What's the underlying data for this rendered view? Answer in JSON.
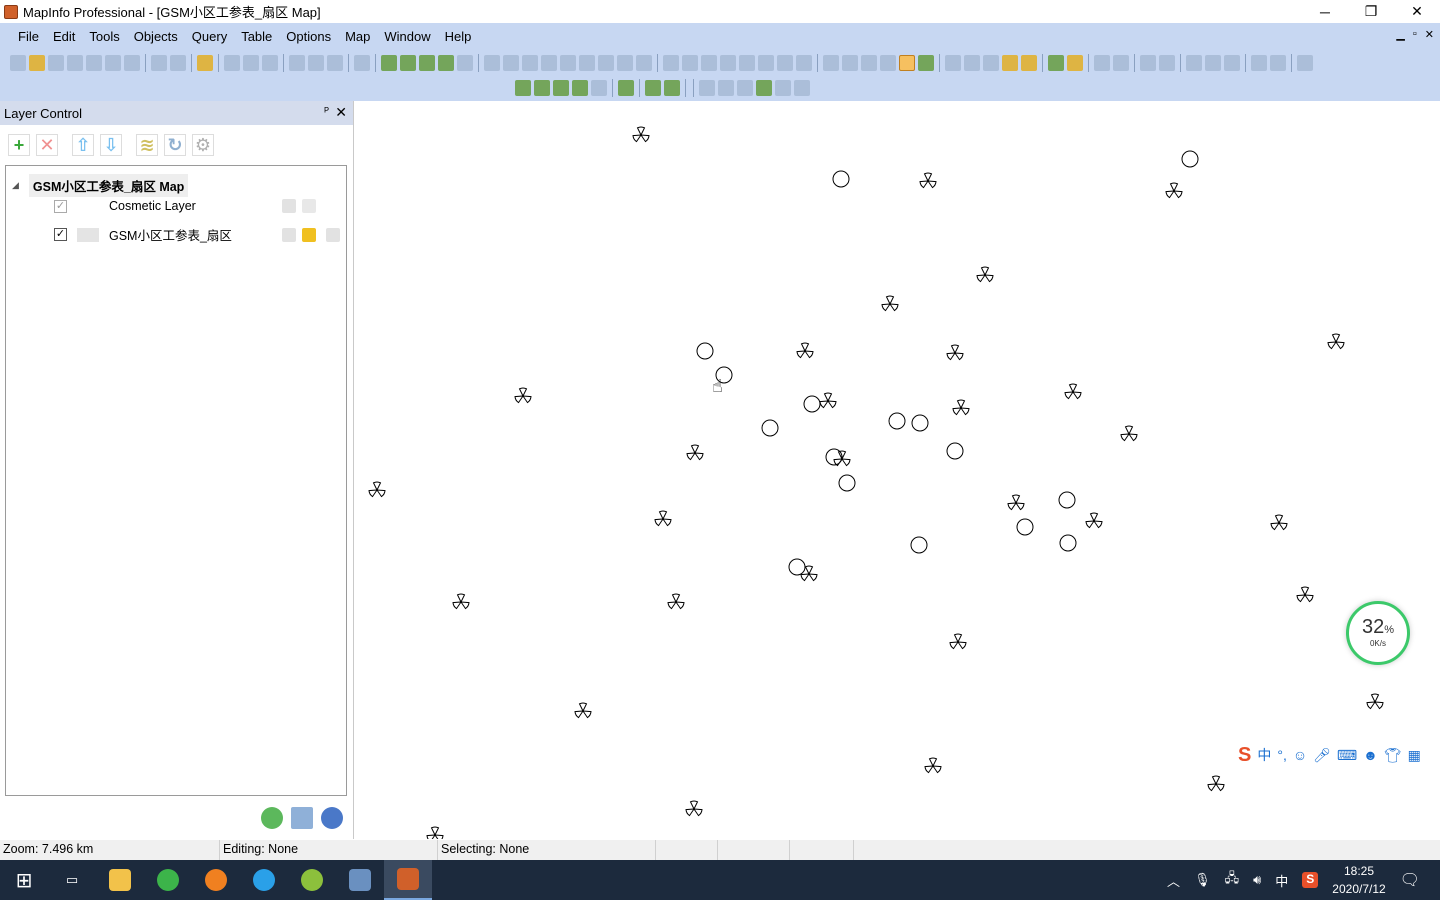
{
  "window": {
    "title": "MapInfo Professional - [GSM小区工参表_扇区 Map]",
    "minimize": "─",
    "restore": "❐",
    "close": "✕"
  },
  "menu": [
    "File",
    "Edit",
    "Tools",
    "Objects",
    "Query",
    "Table",
    "Options",
    "Map",
    "Window",
    "Help"
  ],
  "mdi_controls": [
    "▁",
    "▫",
    "✕"
  ],
  "layer_control": {
    "title": "Layer Control",
    "pin": "ᴾ",
    "close": "✕",
    "map_name": "GSM小区工参表_扇区 Map",
    "layers": [
      {
        "name": "Cosmetic Layer",
        "visible": true,
        "enabled": false
      },
      {
        "name": "GSM小区工参表_扇区",
        "visible": true,
        "enabled": true
      }
    ]
  },
  "status": {
    "zoom": "Zoom: 7.496 km",
    "editing": "Editing: None",
    "selecting": "Selecting: None"
  },
  "speed_widget": {
    "percent": "32",
    "unit": "%",
    "rate": "0K/s"
  },
  "ime_bar": {
    "label": "中"
  },
  "tray": {
    "lang": "中",
    "time": "18:25",
    "date": "2020/7/12"
  },
  "colors": {
    "menubar": "#c7d7f2",
    "taskbar": "#1c2a3d",
    "accent_green": "#3cc96a"
  }
}
